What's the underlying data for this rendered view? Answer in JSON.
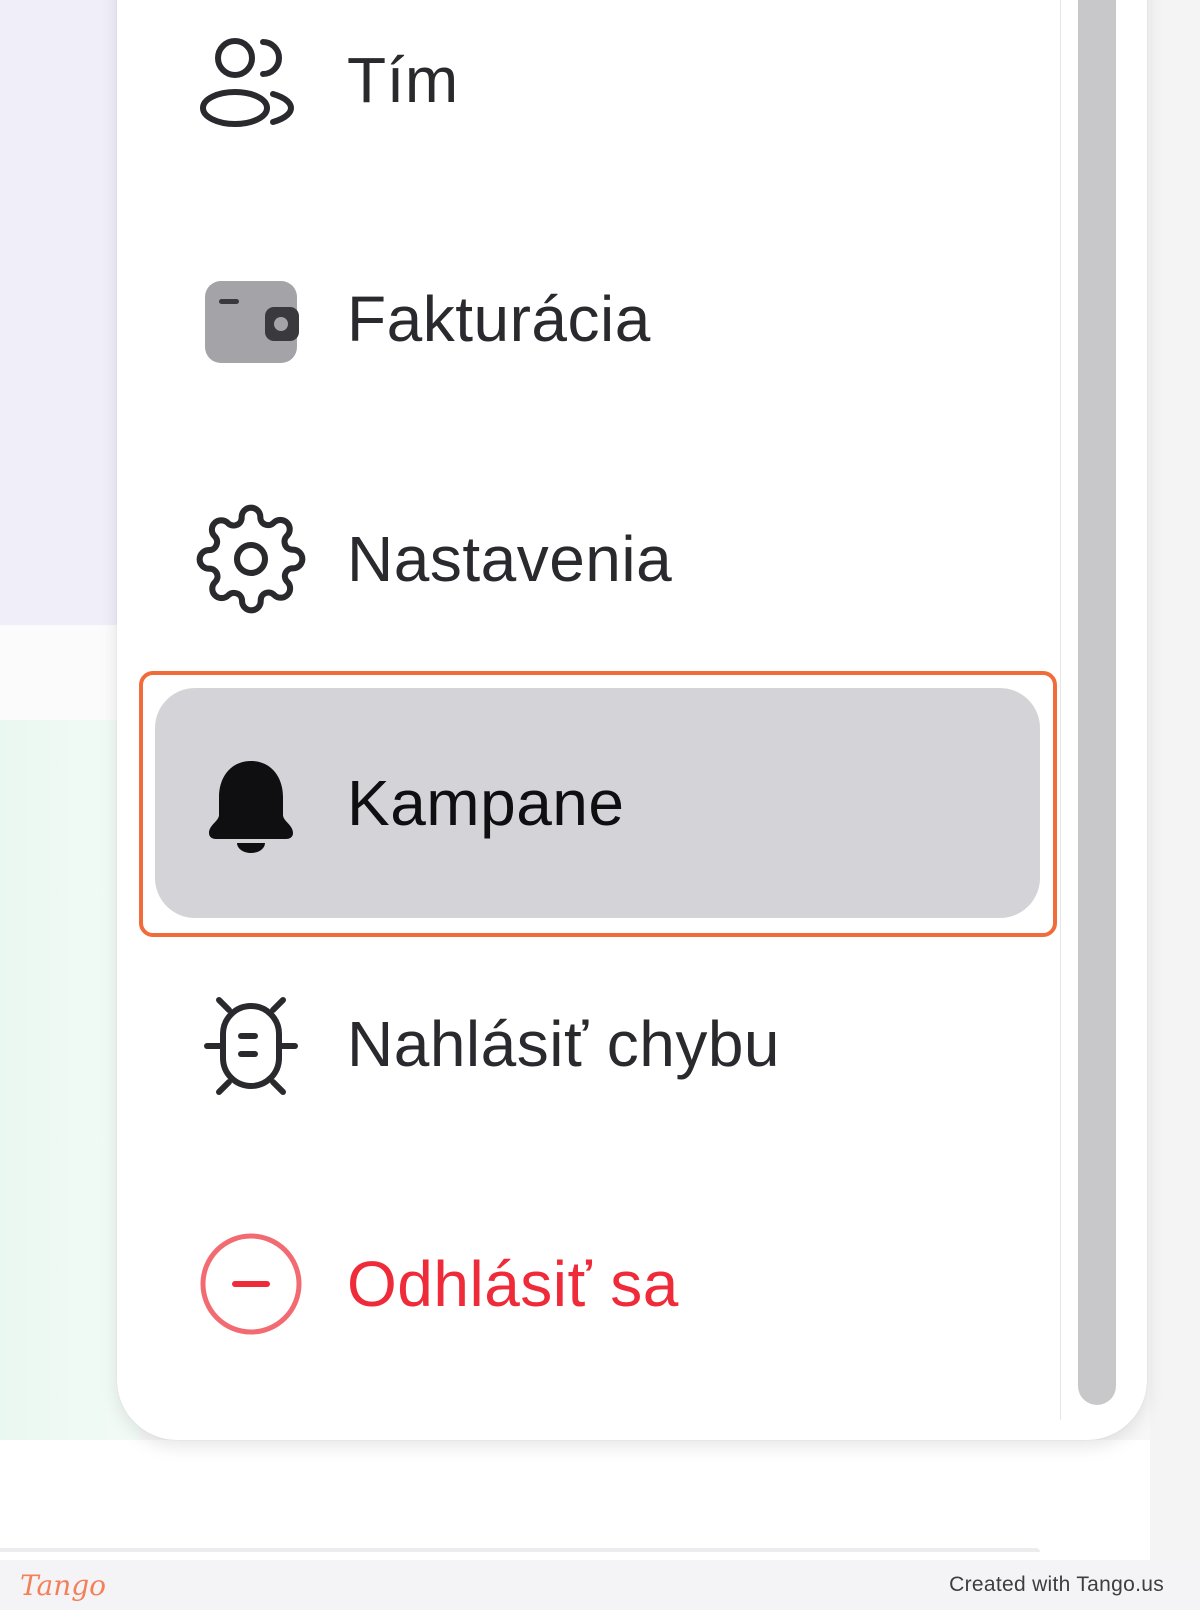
{
  "menu": {
    "items": [
      {
        "label": "Tím",
        "icon": "team-icon"
      },
      {
        "label": "Fakturácia",
        "icon": "wallet-icon"
      },
      {
        "label": "Nastavenia",
        "icon": "gear-icon"
      },
      {
        "label": "Kampane",
        "icon": "bell-icon",
        "active": true
      },
      {
        "label": "Nahlásiť chybu",
        "icon": "bug-icon"
      },
      {
        "label": "Odhlásiť sa",
        "icon": "logout-minus-circle-icon",
        "danger": true
      }
    ]
  },
  "footer": {
    "brand": "Tango",
    "credit": "Created with Tango.us"
  },
  "colors": {
    "highlight": "#f26b3a",
    "danger": "#ef2b3a",
    "active_bg": "#d4d4d8"
  }
}
